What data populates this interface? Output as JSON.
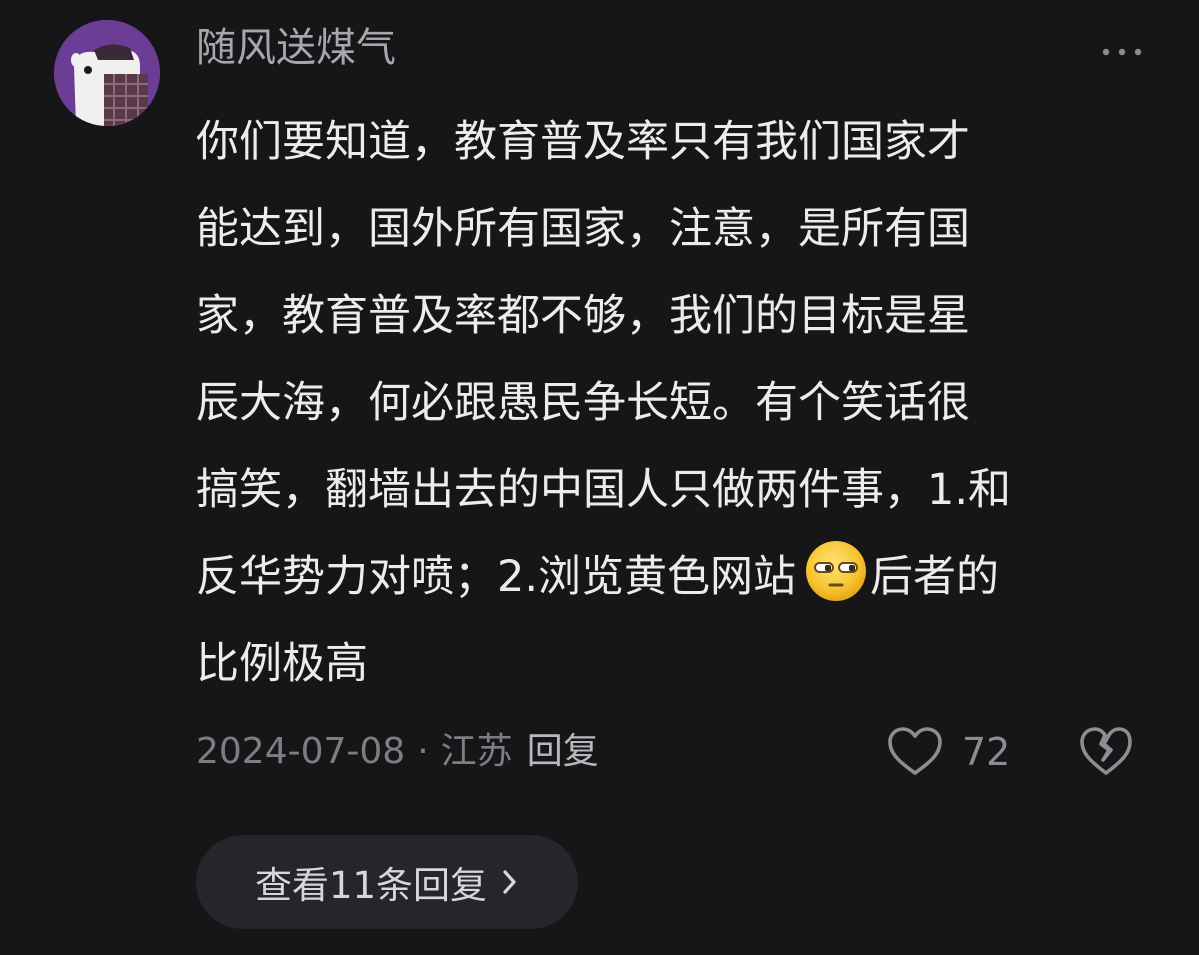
{
  "comment": {
    "username": "随风送煤气",
    "body_lines": [
      "你们要知道，教育普及率只有我们国家才",
      "能达到，国外所有国家，注意，是所有国",
      "家，教育普及率都不够，我们的目标是星",
      "辰大海，何必跟愚民争长短。有个笑话很",
      "搞笑，翻墙出去的中国人只做两件事，1.和"
    ],
    "line6_before_emoji": "反华势力对喷；2.浏览黄色网站",
    "emoji_icon": "smug-face-emoji",
    "line6_after_emoji": "后者的",
    "line7": "比例极高",
    "date": "2024-07-08",
    "separator": "·",
    "location": "江苏",
    "reply_label": "回复",
    "like_count": "72",
    "view_replies_label": "查看11条回复",
    "avatar_color": "#6c3d94",
    "text_color": "#ececee",
    "muted_color": "#7d7d82"
  }
}
